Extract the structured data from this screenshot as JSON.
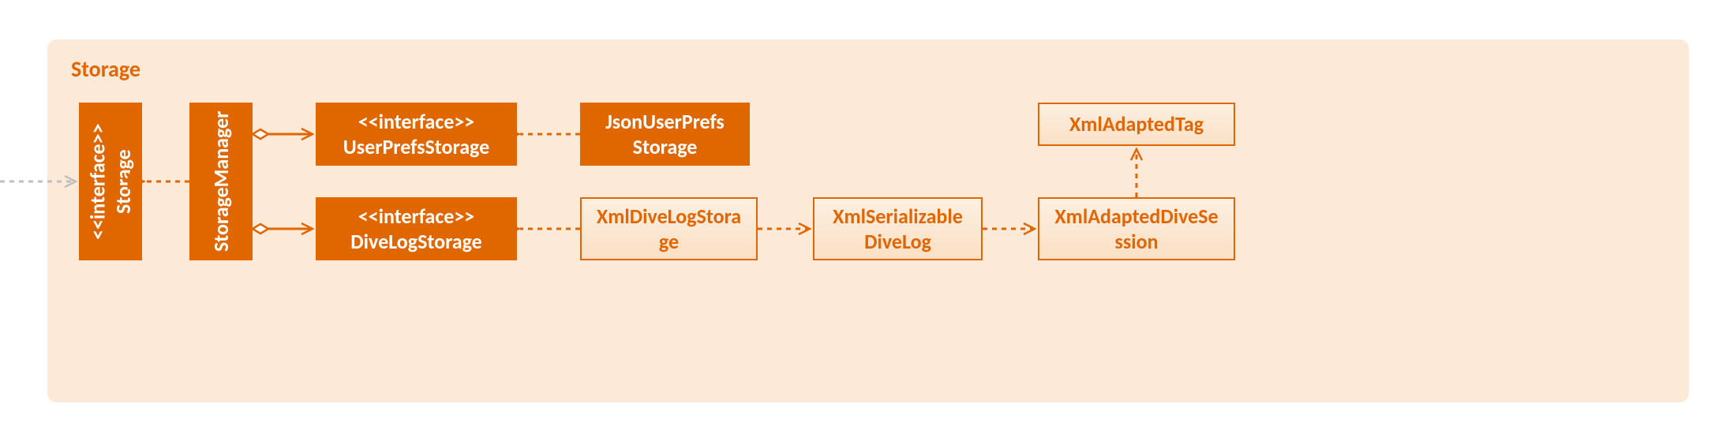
{
  "package": {
    "title": "Storage"
  },
  "classes": {
    "storage_iface": {
      "stereo": "<<interface>>",
      "name": "Storage"
    },
    "storage_manager": {
      "name": "StorageManager"
    },
    "userprefs_iface": {
      "stereo": "<<interface>>",
      "name": "UserPrefsStorage"
    },
    "divelog_iface": {
      "stereo": "<<interface>>",
      "name": "DiveLogStorage"
    },
    "json_userprefs": {
      "line1": "JsonUserPrefs",
      "line2": "Storage"
    },
    "xml_divelog_storage": {
      "line1": "XmlDiveLogStora",
      "line2": "ge"
    },
    "xml_serializable": {
      "line1": "XmlSerializable",
      "line2": "DiveLog"
    },
    "xml_adapted_session": {
      "line1": "XmlAdaptedDiveSe",
      "line2": "ssion"
    },
    "xml_adapted_tag": {
      "name": "XmlAdaptedTag"
    }
  },
  "colors": {
    "accent": "#e06600",
    "package_bg": "#fce9d8",
    "light_fill_top": "#fdefe1",
    "light_fill_bottom": "#fbe0c5",
    "gray_arrow": "#bfbfbf"
  },
  "diagram_semantics": {
    "package": "Storage",
    "elements": [
      {
        "id": "storage_iface",
        "kind": "interface",
        "name": "Storage"
      },
      {
        "id": "storage_manager",
        "kind": "class",
        "name": "StorageManager"
      },
      {
        "id": "userprefs_iface",
        "kind": "interface",
        "name": "UserPrefsStorage"
      },
      {
        "id": "divelog_iface",
        "kind": "interface",
        "name": "DiveLogStorage"
      },
      {
        "id": "json_userprefs",
        "kind": "class",
        "name": "JsonUserPrefsStorage"
      },
      {
        "id": "xml_divelog_storage",
        "kind": "class",
        "name": "XmlDiveLogStorage"
      },
      {
        "id": "xml_serializable",
        "kind": "class",
        "name": "XmlSerializableDiveLog"
      },
      {
        "id": "xml_adapted_session",
        "kind": "class",
        "name": "XmlAdaptedDiveSession"
      },
      {
        "id": "xml_adapted_tag",
        "kind": "class",
        "name": "XmlAdaptedTag"
      }
    ],
    "relationships": [
      {
        "from": "external",
        "to": "storage_iface",
        "type": "dependency"
      },
      {
        "from": "storage_manager",
        "to": "storage_iface",
        "type": "realization"
      },
      {
        "from": "storage_manager",
        "to": "userprefs_iface",
        "type": "aggregation"
      },
      {
        "from": "storage_manager",
        "to": "divelog_iface",
        "type": "aggregation"
      },
      {
        "from": "json_userprefs",
        "to": "userprefs_iface",
        "type": "realization"
      },
      {
        "from": "xml_divelog_storage",
        "to": "divelog_iface",
        "type": "realization"
      },
      {
        "from": "xml_divelog_storage",
        "to": "xml_serializable",
        "type": "dependency"
      },
      {
        "from": "xml_serializable",
        "to": "xml_adapted_session",
        "type": "dependency"
      },
      {
        "from": "xml_adapted_session",
        "to": "xml_adapted_tag",
        "type": "dependency"
      }
    ]
  }
}
